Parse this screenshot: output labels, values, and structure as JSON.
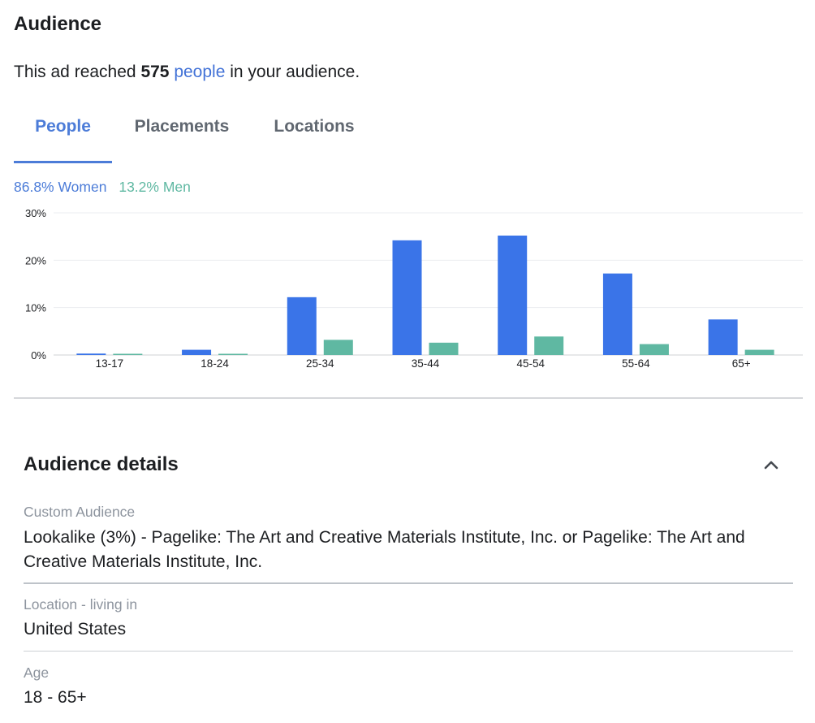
{
  "header": {
    "title": "Audience",
    "reach_prefix": "This ad reached",
    "reach_count": "575",
    "reach_link": "people",
    "reach_suffix": "in your audience."
  },
  "tabs": [
    {
      "label": "People",
      "active": true
    },
    {
      "label": "Placements",
      "active": false
    },
    {
      "label": "Locations",
      "active": false
    }
  ],
  "legend": {
    "women": "86.8% Women",
    "men": "13.2% Men"
  },
  "colors": {
    "women": "#3a74e8",
    "men": "#5fb8a2",
    "accent": "#4c7cd8"
  },
  "chart_data": {
    "type": "bar",
    "categories": [
      "13-17",
      "18-24",
      "25-34",
      "35-44",
      "45-54",
      "55-64",
      "65+"
    ],
    "series": [
      {
        "values": [
          0.3,
          1.1,
          12.2,
          24.2,
          25.2,
          17.2,
          7.5
        ]
      },
      {
        "values": [
          0.2,
          0.2,
          3.2,
          2.6,
          3.9,
          2.3,
          1.1
        ]
      }
    ],
    "yticks": [
      "0%",
      "10%",
      "20%",
      "30%"
    ],
    "ylim": [
      0,
      30
    ],
    "grid": true
  },
  "details": {
    "title": "Audience details",
    "collapse_icon": "chevron-up-icon",
    "fields": [
      {
        "label": "Custom Audience",
        "value": "Lookalike (3%) - Pagelike: The Art and Creative Materials Institute, Inc. or Pagelike: The Art and Creative Materials Institute, Inc."
      },
      {
        "label": "Location - living in",
        "value": "United States"
      },
      {
        "label": "Age",
        "value": "18 - 65+"
      }
    ]
  }
}
